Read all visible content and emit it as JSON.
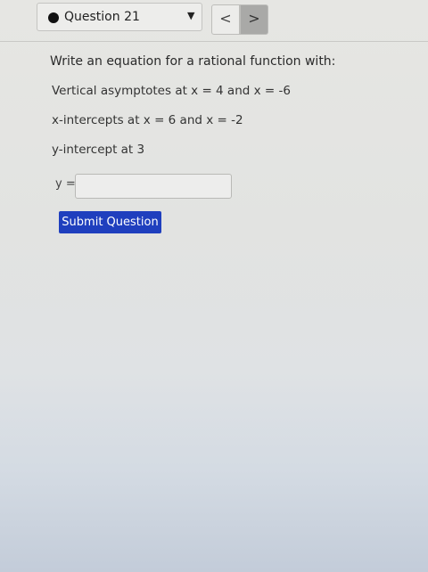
{
  "header": {
    "question_label": "Question 21",
    "status_color": "#111111",
    "prev_glyph": "<",
    "next_glyph": ">",
    "dropdown_glyph": "▼"
  },
  "question": {
    "prompt": "Write an equation for a rational function with:",
    "conditions": [
      "Vertical asymptotes at x = 4 and x = -6",
      "x-intercepts at x = 6 and x = -2",
      "y-intercept at 3"
    ]
  },
  "answer": {
    "label": "y =",
    "value": "",
    "placeholder": ""
  },
  "submit": {
    "label": "Submit Question",
    "color": "#1f3fbe"
  }
}
